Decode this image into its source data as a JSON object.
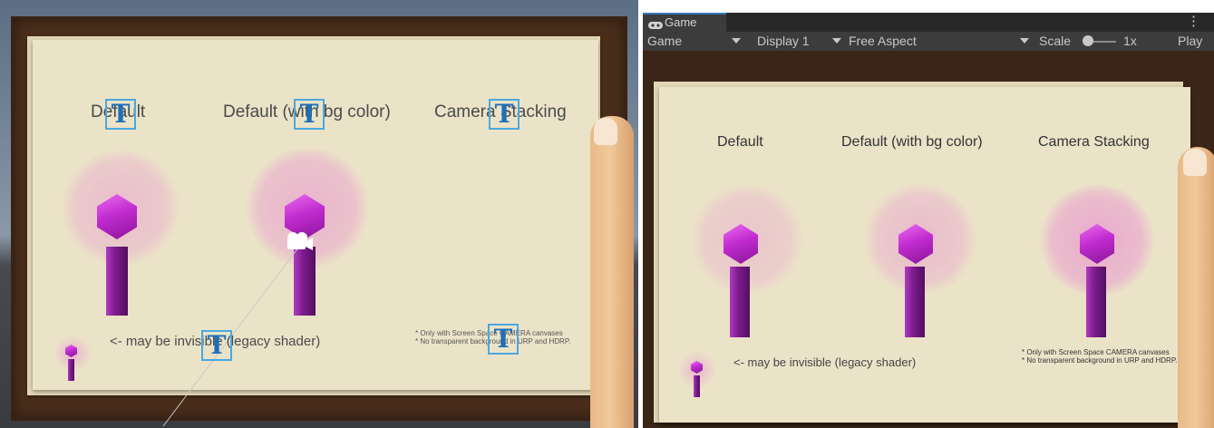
{
  "scene_view": {
    "labels": [
      "Default",
      "Default (with bg color)",
      "Camera Stacking"
    ],
    "legacy_note": "<- may be invisible (legacy shader)",
    "stacking_note_1": "* Only with Screen Space CAMERA canvases",
    "stacking_note_2": "* No transparent background in URP and HDRP.",
    "text_gizmo_glyph": "T",
    "icons": [
      "text-gizmo-icon",
      "camera-gizmo-icon"
    ]
  },
  "game_view": {
    "tab_label": "Game",
    "tab_icon": "gamepad-icon",
    "menu_icon": "kebab-menu-icon",
    "menu_glyph": "⋮",
    "toolbar": {
      "mode": "Game",
      "display": "Display 1",
      "aspect": "Free Aspect",
      "scale_label": "Scale",
      "scale_value": "1x",
      "scale_slider_level": 0.1,
      "play_label": "Play"
    },
    "labels": [
      "Default",
      "Default (with bg color)",
      "Camera Stacking"
    ],
    "legacy_note": "<- may be invisible (legacy shader)",
    "stacking_note_1": "* Only with Screen Space CAMERA canvases",
    "stacking_note_2": "* No transparent background in URP and HDRP."
  },
  "colors": {
    "accent_blue": "#3a79bb",
    "particle_pink": "#e85ad6",
    "crystal_magenta": "#c12cd0",
    "paper": "#ebe3c8",
    "frame_brown": "#4a2e1b"
  }
}
